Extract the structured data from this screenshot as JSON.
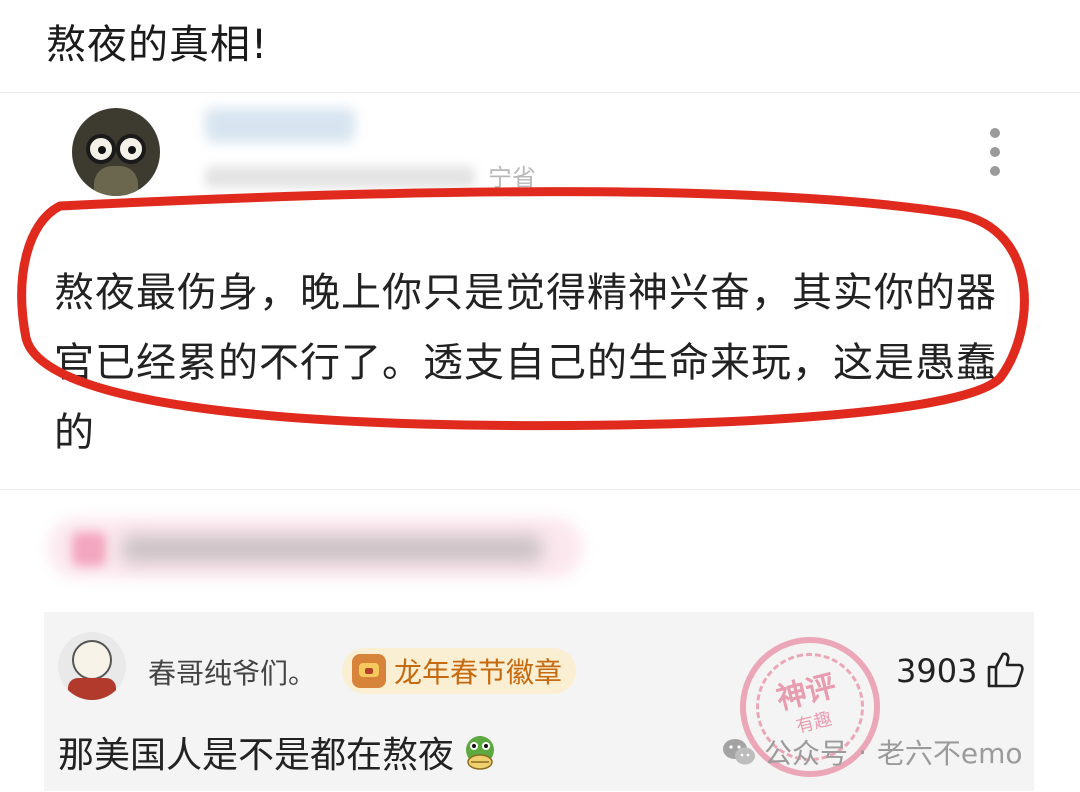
{
  "page": {
    "title": "熬夜的真相!"
  },
  "post": {
    "location_suffix": "宁省",
    "text": "熬夜最伤身，晚上你只是觉得精神兴奋，其实你的器官已经累的不行了。透支自己的生命来玩，这是愚蠢的"
  },
  "comment": {
    "username": "春哥纯爷们。",
    "badge_label": "龙年春节徽章",
    "like_count": "3903",
    "text": "那美国人是不是都在熬夜"
  },
  "watermark": {
    "source": "公众号",
    "dot": "·",
    "account": "老六不emo",
    "stamp_top": "神评",
    "stamp_bottom": "有趣"
  },
  "colors": {
    "highlight_ring": "#e02a1e",
    "badge_text": "#c66a10",
    "stamp": "#e56a86"
  }
}
